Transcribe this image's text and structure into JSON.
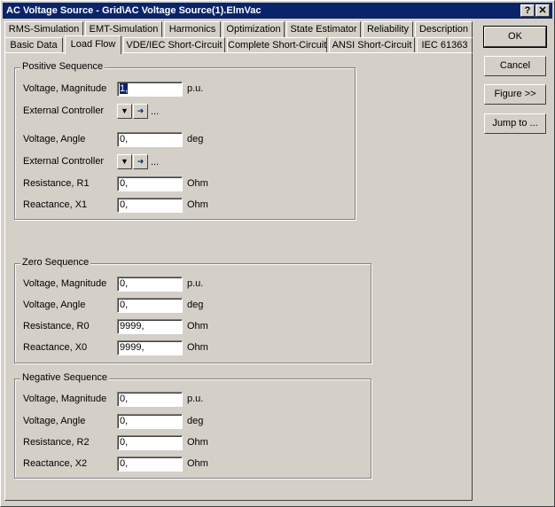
{
  "window": {
    "title": "AC Voltage Source - Grid\\AC Voltage Source(1).ElmVac",
    "help_label": "?",
    "close_label": "✕"
  },
  "tabs_top": [
    "RMS-Simulation",
    "EMT-Simulation",
    "Harmonics",
    "Optimization",
    "State Estimator",
    "Reliability",
    "Description"
  ],
  "tabs_bottom": [
    "Basic Data",
    "Load Flow",
    "VDE/IEC Short-Circuit",
    "Complete Short-Circuit",
    "ANSI Short-Circuit",
    "IEC 61363"
  ],
  "active_tab": "Load Flow",
  "positive": {
    "title": "Positive Sequence",
    "voltage_magnitude": {
      "label": "Voltage, Magnitude",
      "value": "1,",
      "unit": "p.u."
    },
    "ext_controller_1": {
      "label": "External Controller",
      "dots": "..."
    },
    "voltage_angle": {
      "label": "Voltage, Angle",
      "value": "0,",
      "unit": "deg"
    },
    "ext_controller_2": {
      "label": "External Controller",
      "dots": "..."
    },
    "resistance": {
      "label": "Resistance, R1",
      "value": "0,",
      "unit": "Ohm"
    },
    "reactance": {
      "label": "Reactance, X1",
      "value": "0,",
      "unit": "Ohm"
    }
  },
  "zero": {
    "title": "Zero Sequence",
    "voltage_magnitude": {
      "label": "Voltage, Magnitude",
      "value": "0,",
      "unit": "p.u."
    },
    "voltage_angle": {
      "label": "Voltage, Angle",
      "value": "0,",
      "unit": "deg"
    },
    "resistance": {
      "label": "Resistance, R0",
      "value": "9999,",
      "unit": "Ohm"
    },
    "reactance": {
      "label": "Reactance, X0",
      "value": "9999,",
      "unit": "Ohm"
    }
  },
  "negative": {
    "title": "Negative Sequence",
    "voltage_magnitude": {
      "label": "Voltage, Magnitude",
      "value": "0,",
      "unit": "p.u."
    },
    "voltage_angle": {
      "label": "Voltage, Angle",
      "value": "0,",
      "unit": "deg"
    },
    "resistance": {
      "label": "Resistance, R2",
      "value": "0,",
      "unit": "Ohm"
    },
    "reactance": {
      "label": "Reactance, X2",
      "value": "0,",
      "unit": "Ohm"
    }
  },
  "buttons": {
    "ok": "OK",
    "cancel": "Cancel",
    "figure": "Figure >>",
    "jump": "Jump to ..."
  }
}
